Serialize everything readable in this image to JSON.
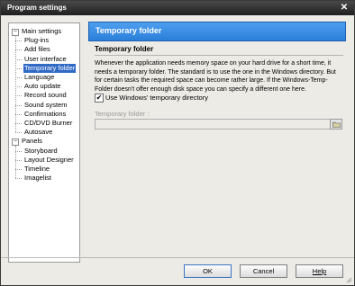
{
  "window": {
    "title": "Program settings"
  },
  "tree": {
    "groups": [
      {
        "label": "Main settings",
        "expanded": true,
        "items": [
          "Plug-ins",
          "Add files",
          "User interface",
          "Temporary folder",
          "Language",
          "Auto update",
          "Record sound",
          "Sound system",
          "Confirmations",
          "CD/DVD Burner",
          "Autosave"
        ]
      },
      {
        "label": "Panels",
        "expanded": true,
        "items": [
          "Storyboard",
          "Layout Designer",
          "Timeline",
          "Imagelist"
        ]
      }
    ],
    "selected": "Temporary folder"
  },
  "panel": {
    "header": "Temporary folder",
    "section_title": "Temporary folder",
    "description": "Whenever the application needs memory space on your hard drive for a short time, it needs a temporary folder. The standard is to use the one in the Windows directory. But for certain tasks the required space can become rather large. If the Windows-Temp-Folder doesn't offer enough disk space you can specify a different one here.",
    "checkbox_label": "Use Windows' temporary directory",
    "checkbox_checked": true,
    "field_label": "Temporary folder :",
    "field_value": ""
  },
  "buttons": {
    "ok": "OK",
    "cancel": "Cancel",
    "help": "Help"
  },
  "colors": {
    "header_blue": "#2a7fd9",
    "selection": "#316ac5",
    "titlebar": "#1f1f1f"
  }
}
